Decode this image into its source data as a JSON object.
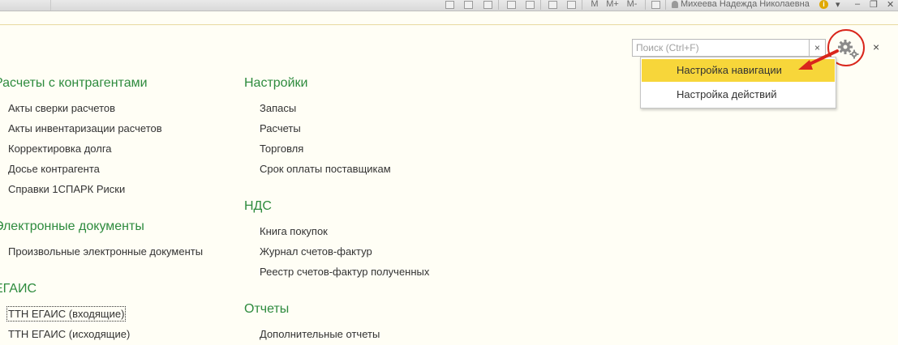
{
  "toolbar": {
    "memory_buttons": [
      "M",
      "M+",
      "M-"
    ],
    "user_name": "Михеева Надежда Николаевна",
    "info_label": "i",
    "dropdown_caret": "▾",
    "minimize": "–",
    "restore": "❐",
    "close": "✕"
  },
  "search": {
    "placeholder": "Поиск (Ctrl+F)",
    "clear_label": "×"
  },
  "panel_close": "×",
  "menu": {
    "items": [
      {
        "label": "Настройка навигации",
        "selected": true
      },
      {
        "label": "Настройка действий",
        "selected": false
      }
    ]
  },
  "sections": {
    "left": [
      {
        "title": "Расчеты с контрагентами",
        "items": [
          "Акты сверки расчетов",
          "Акты инвентаризации расчетов",
          "Корректировка долга",
          "Досье контрагента",
          "Справки 1СПАРК Риски"
        ]
      },
      {
        "title": "Электронные документы",
        "items": [
          "Произвольные электронные документы"
        ]
      },
      {
        "title": "ЕГАИС",
        "items": [
          "ТТН ЕГАИС (входящие)",
          "ТТН ЕГАИС (исходящие)"
        ]
      }
    ],
    "right": [
      {
        "title": "Настройки",
        "items": [
          "Запасы",
          "Расчеты",
          "Торговля",
          "Срок оплаты поставщикам"
        ]
      },
      {
        "title": "НДС",
        "items": [
          "Книга покупок",
          "Журнал счетов-фактур",
          "Реестр счетов-фактур полученных"
        ]
      },
      {
        "title": "Отчеты",
        "items": [
          "Дополнительные отчеты"
        ]
      }
    ]
  },
  "colors": {
    "heading": "#2e8b3e",
    "selected_menu": "#f7d63a",
    "highlight_ring": "#d9261c"
  }
}
